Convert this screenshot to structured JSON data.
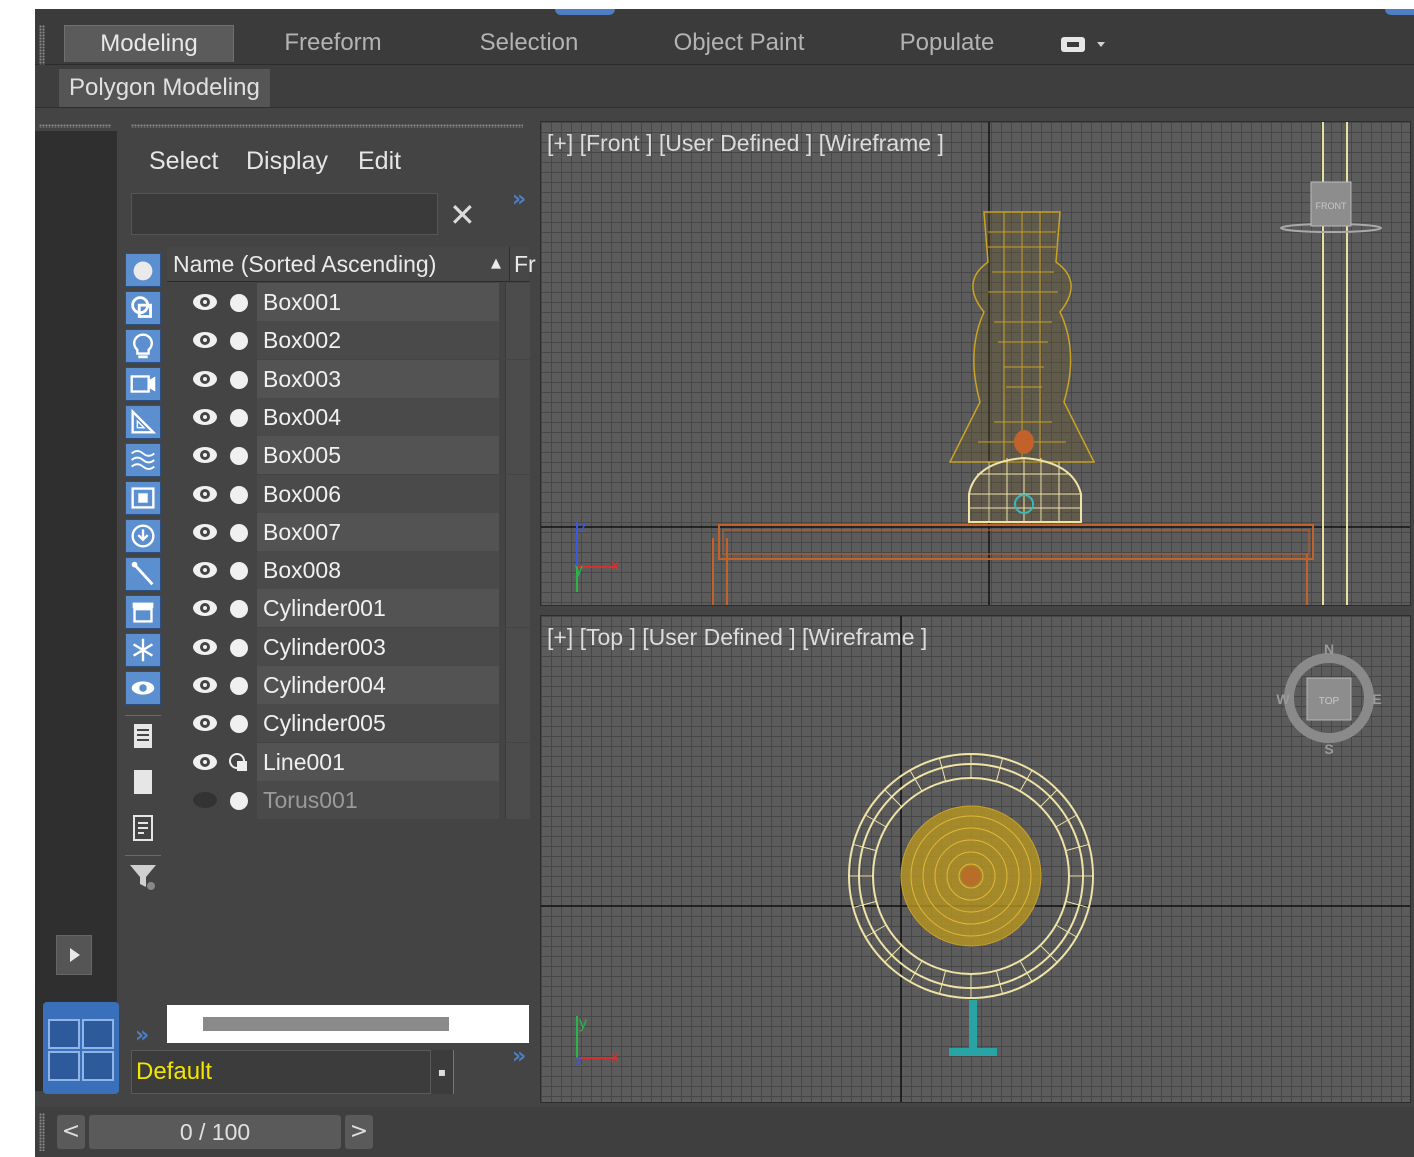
{
  "ribbon": {
    "tabs": [
      {
        "label": "Modeling",
        "active": true
      },
      {
        "label": "Freeform",
        "active": false
      },
      {
        "label": "Selection",
        "active": false
      },
      {
        "label": "Object Paint",
        "active": false
      },
      {
        "label": "Populate",
        "active": false
      }
    ],
    "subtab": "Polygon Modeling"
  },
  "scene_explorer": {
    "menu": [
      "Select",
      "Display",
      "Edit"
    ],
    "search": {
      "value": "",
      "placeholder": ""
    },
    "column_name": "Name (Sorted Ascending)",
    "column_fr": "Fr",
    "objects": [
      {
        "name": "Box001",
        "visible": true,
        "type": "geometry"
      },
      {
        "name": "Box002",
        "visible": true,
        "type": "geometry"
      },
      {
        "name": "Box003",
        "visible": true,
        "type": "geometry"
      },
      {
        "name": "Box004",
        "visible": true,
        "type": "geometry"
      },
      {
        "name": "Box005",
        "visible": true,
        "type": "geometry"
      },
      {
        "name": "Box006",
        "visible": true,
        "type": "geometry"
      },
      {
        "name": "Box007",
        "visible": true,
        "type": "geometry"
      },
      {
        "name": "Box008",
        "visible": true,
        "type": "geometry"
      },
      {
        "name": "Cylinder001",
        "visible": true,
        "type": "geometry"
      },
      {
        "name": "Cylinder003",
        "visible": true,
        "type": "geometry"
      },
      {
        "name": "Cylinder004",
        "visible": true,
        "type": "geometry"
      },
      {
        "name": "Cylinder005",
        "visible": true,
        "type": "geometry"
      },
      {
        "name": "Line001",
        "visible": true,
        "type": "shape"
      },
      {
        "name": "Torus001",
        "visible": false,
        "type": "geometry"
      }
    ],
    "layer": "Default"
  },
  "viewports": {
    "front": {
      "label": "[+] [Front ] [User Defined ] [Wireframe ]",
      "cube_label": "FRONT"
    },
    "top": {
      "label": "[+] [Top ] [User Defined ] [Wireframe ]",
      "cube_label": "TOP",
      "compass": {
        "n": "N",
        "s": "S",
        "e": "E",
        "w": "W"
      }
    },
    "axis": {
      "x": "x",
      "y": "y",
      "z": "z"
    }
  },
  "timeline": {
    "frame": "0 / 100",
    "prev": "<",
    "next": ">"
  },
  "colors": {
    "accent": "#5b8fd0",
    "layer_text": "#f2e600",
    "wire_gold": "#c9a227",
    "wire_cream": "#efe3a6",
    "wire_orange": "#c0622a"
  }
}
